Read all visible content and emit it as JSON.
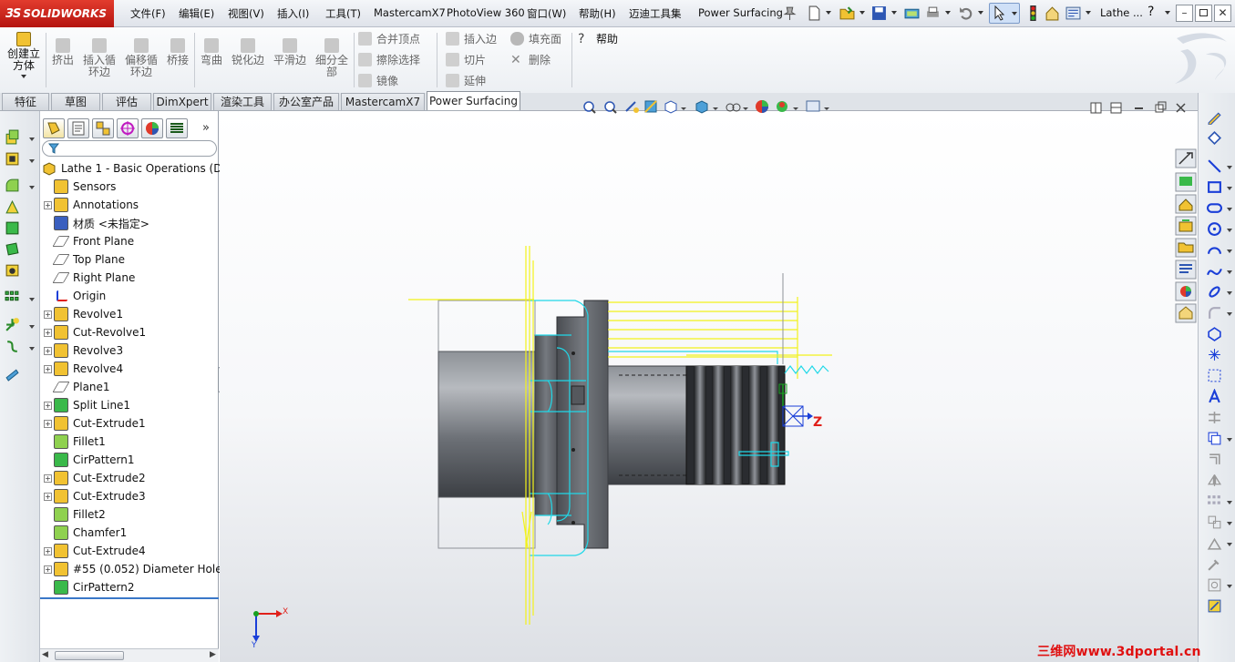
{
  "app": {
    "logo_text": "SOLIDWORKS",
    "logo_prefix": "3S"
  },
  "menu": [
    {
      "label": "文件(F)"
    },
    {
      "label": "编辑(E)"
    },
    {
      "label": "视图(V)"
    },
    {
      "label": "插入(I)"
    },
    {
      "label": "工具(T)"
    },
    {
      "label": "MastercamX7"
    },
    {
      "label": "PhotoView 360"
    },
    {
      "label": "窗口(W)"
    },
    {
      "label": "帮助(H)"
    },
    {
      "label": "迈迪工具集"
    },
    {
      "label": "Power Surfacing"
    }
  ],
  "titlebar": {
    "doc_name": "Lathe ...",
    "help_icon": "?"
  },
  "command_manager": {
    "large_buttons": [
      {
        "label": "创建立\n方体",
        "icon": "cube-icon"
      },
      {
        "label": "挤出",
        "icon": "extrude-icon"
      },
      {
        "label": "插入循\n环边",
        "icon": "insert-loop-icon"
      },
      {
        "label": "偏移循\n环边",
        "icon": "offset-loop-icon"
      },
      {
        "label": "桥接",
        "icon": "bridge-icon"
      },
      {
        "label": "弯曲",
        "icon": "bend-icon"
      },
      {
        "label": "锐化边",
        "icon": "sharpen-edge-icon"
      },
      {
        "label": "平滑边",
        "icon": "smooth-edge-icon"
      },
      {
        "label": "细分全\n部",
        "icon": "subdivide-all-icon"
      }
    ],
    "small_buttons_col1": [
      {
        "label": "合并顶点",
        "icon": "merge-vertex-icon"
      },
      {
        "label": "擦除选择",
        "icon": "erase-selection-icon"
      },
      {
        "label": "镜像",
        "icon": "mirror-icon"
      }
    ],
    "small_buttons_col2": [
      {
        "label": "插入边",
        "icon": "insert-edge-icon"
      },
      {
        "label": "切片",
        "icon": "slice-icon"
      },
      {
        "label": "延伸",
        "icon": "extend-icon"
      }
    ],
    "small_buttons_col3": [
      {
        "label": "填充面",
        "icon": "fill-face-icon"
      },
      {
        "label": "删除",
        "icon": "delete-icon"
      }
    ],
    "help": {
      "label": "帮助",
      "icon": "help-icon"
    }
  },
  "tabs": [
    {
      "label": "特征"
    },
    {
      "label": "草图"
    },
    {
      "label": "评估"
    },
    {
      "label": "DimXpert"
    },
    {
      "label": "渲染工具"
    },
    {
      "label": "办公室产品"
    },
    {
      "label": "MastercamX7"
    },
    {
      "label": "Power Surfacing",
      "active": true
    }
  ],
  "feature_tree": {
    "root": "Lathe 1 - Basic Operations  (D",
    "items": [
      {
        "label": "Sensors",
        "icon": "sensor-icon",
        "expandable": false
      },
      {
        "label": "Annotations",
        "icon": "annotation-icon",
        "expandable": true
      },
      {
        "label": "材质 <未指定>",
        "icon": "material-icon",
        "expandable": false
      },
      {
        "label": "Front Plane",
        "icon": "plane-icon",
        "expandable": false
      },
      {
        "label": "Top Plane",
        "icon": "plane-icon",
        "expandable": false
      },
      {
        "label": "Right Plane",
        "icon": "plane-icon",
        "expandable": false
      },
      {
        "label": "Origin",
        "icon": "origin-icon",
        "expandable": false
      },
      {
        "label": "Revolve1",
        "icon": "revolve-icon",
        "expandable": true
      },
      {
        "label": "Cut-Revolve1",
        "icon": "cut-revolve-icon",
        "expandable": true
      },
      {
        "label": "Revolve3",
        "icon": "revolve-icon",
        "expandable": true
      },
      {
        "label": "Revolve4",
        "icon": "revolve-icon",
        "expandable": true
      },
      {
        "label": "Plane1",
        "icon": "plane-icon",
        "expandable": false
      },
      {
        "label": "Split Line1",
        "icon": "split-line-icon",
        "expandable": true
      },
      {
        "label": "Cut-Extrude1",
        "icon": "cut-extrude-icon",
        "expandable": true
      },
      {
        "label": "Fillet1",
        "icon": "fillet-icon",
        "expandable": false
      },
      {
        "label": "CirPattern1",
        "icon": "pattern-icon",
        "expandable": false
      },
      {
        "label": "Cut-Extrude2",
        "icon": "cut-extrude-icon",
        "expandable": true
      },
      {
        "label": "Cut-Extrude3",
        "icon": "cut-extrude-icon",
        "expandable": true
      },
      {
        "label": "Fillet2",
        "icon": "fillet-icon",
        "expandable": false
      },
      {
        "label": "Chamfer1",
        "icon": "chamfer-icon",
        "expandable": false
      },
      {
        "label": "Cut-Extrude4",
        "icon": "cut-extrude-icon",
        "expandable": true
      },
      {
        "label": "#55 (0.052) Diameter Hole",
        "icon": "hole-icon",
        "expandable": true
      },
      {
        "label": "CirPattern2",
        "icon": "pattern-icon",
        "expandable": false
      }
    ]
  },
  "viewport": {
    "triad": {
      "x_label": "X",
      "y_label": "Y"
    },
    "axis_label_z": "Z"
  },
  "watermark": "三维网www.3dportal.cn",
  "colors": {
    "tool_yellow": "#f2f21a",
    "tool_cyan": "#20d8e8",
    "part_grey": "#6f7278",
    "axis_red": "#e0201a",
    "axis_blue": "#1a3fd8",
    "axis_green": "#18a020"
  }
}
